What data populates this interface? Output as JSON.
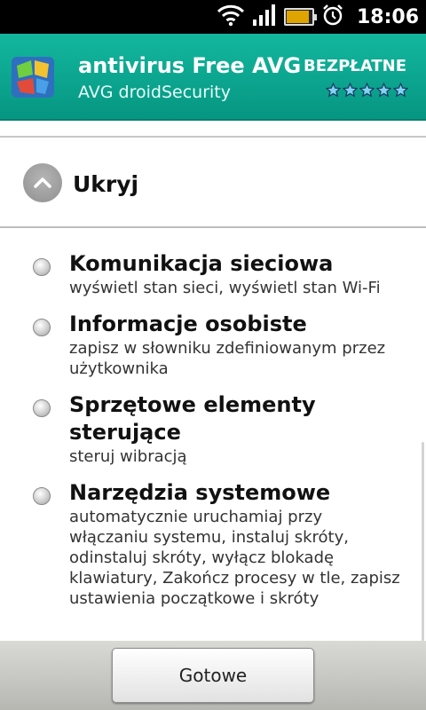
{
  "status_bar": {
    "time": "18:06",
    "icons": [
      "wifi-icon",
      "signal-icon",
      "battery-icon",
      "alarm-icon"
    ],
    "battery_level": 0.9
  },
  "app": {
    "title": "antivirus Free AVG",
    "developer": "AVG droidSecurity",
    "price": "BEZPŁATNE",
    "rating": 5,
    "accent_color": "#0aa58f"
  },
  "section": {
    "hide_label": "Ukryj",
    "toggle_icon": "chevron-up-icon"
  },
  "permissions": [
    {
      "title": "Komunikacja sieciowa",
      "description": "wyświetl stan sieci, wyświetl stan Wi-Fi"
    },
    {
      "title": "Informacje osobiste",
      "description": "zapisz w słowniku zdefiniowanym przez użytkownika"
    },
    {
      "title": "Sprzętowe elementy sterujące",
      "description": "steruj wibracją"
    },
    {
      "title": "Narzędzia systemowe",
      "description": "automatycznie uruchamiaj przy włączaniu systemu, instaluj skróty, odinstaluj skróty, wyłącz blokadę klawiatury, Zakończ procesy w tle, zapisz ustawienia początkowe i skróty"
    }
  ],
  "footer": {
    "done_label": "Gotowe"
  }
}
